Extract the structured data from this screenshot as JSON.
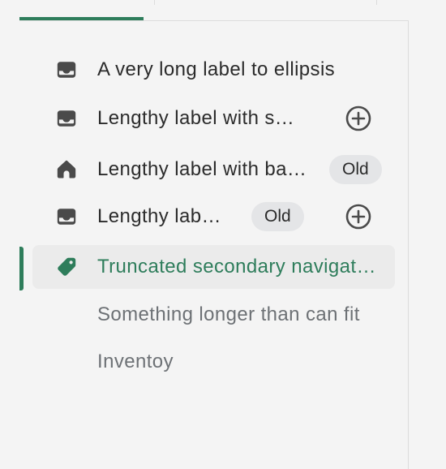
{
  "nav": {
    "items": [
      {
        "label": "A very long label to ellipsis",
        "icon": "inbox-icon"
      },
      {
        "label": "Lengthy label with secondary action",
        "icon": "inbox-icon",
        "action": "add-circle-icon"
      },
      {
        "label": "Lengthy label with badge",
        "icon": "home-icon",
        "badge": "Old"
      },
      {
        "label": "Lengthy label with badge and action",
        "icon": "inbox-icon",
        "badge": "Old",
        "action": "add-circle-icon"
      },
      {
        "label": "Truncated secondary navigation item",
        "icon": "tag-icon",
        "selected": true
      },
      {
        "label": "Something longer than can fit"
      },
      {
        "label": "Inventoy"
      }
    ]
  },
  "colors": {
    "accent": "#2e7d5b",
    "background": "#f4f4f4",
    "selected_bg": "#ebebeb",
    "muted_text": "#6d7175",
    "badge_bg": "#e4e5e7"
  }
}
